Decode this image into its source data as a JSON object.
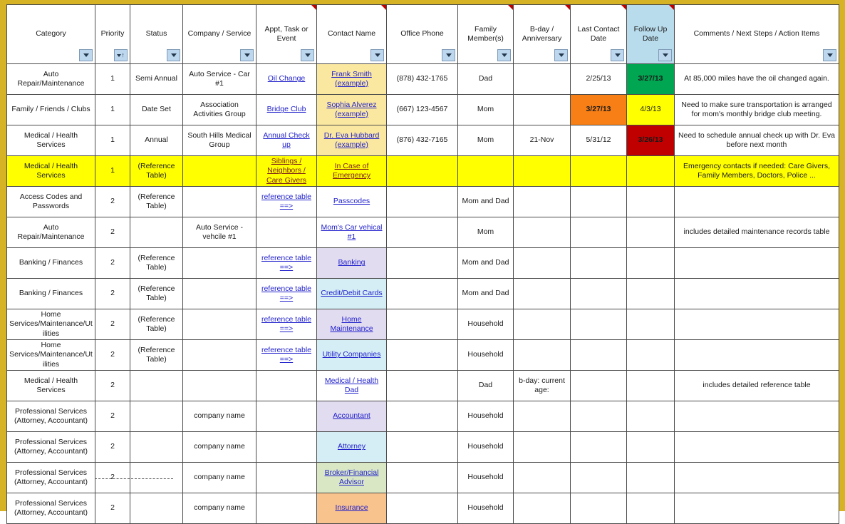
{
  "meta": {
    "doc_type": "spreadsheet",
    "accent_border": "#d6b325",
    "filter_button_color": "#bdd7ee",
    "comment_flag_color": "#c00000"
  },
  "columns": [
    {
      "label": "Category",
      "filter": true,
      "sorted": false,
      "comment_flag": false,
      "highlight": false
    },
    {
      "label": "Priority",
      "filter": true,
      "sorted": true,
      "comment_flag": false,
      "highlight": false
    },
    {
      "label": "Status",
      "filter": true,
      "sorted": false,
      "comment_flag": false,
      "highlight": false
    },
    {
      "label": "Company / Service",
      "filter": true,
      "sorted": false,
      "comment_flag": false,
      "highlight": false
    },
    {
      "label": "Appt, Task or Event",
      "filter": true,
      "sorted": false,
      "comment_flag": true,
      "highlight": false
    },
    {
      "label": "Contact Name",
      "filter": true,
      "sorted": false,
      "comment_flag": true,
      "highlight": false
    },
    {
      "label": "Office Phone",
      "filter": true,
      "sorted": false,
      "comment_flag": false,
      "highlight": false
    },
    {
      "label": "Family Member(s)",
      "filter": true,
      "sorted": false,
      "comment_flag": true,
      "highlight": false
    },
    {
      "label": "B-day / Anniversary",
      "filter": true,
      "sorted": false,
      "comment_flag": true,
      "highlight": false
    },
    {
      "label": "Last Contact Date",
      "filter": true,
      "sorted": false,
      "comment_flag": true,
      "highlight": false
    },
    {
      "label": "Follow Up Date",
      "filter": true,
      "sorted": false,
      "comment_flag": true,
      "highlight": true
    },
    {
      "label": "Comments / Next Steps / Action Items",
      "filter": true,
      "sorted": false,
      "comment_flag": false,
      "highlight": false
    }
  ],
  "rows": [
    {
      "row_style": "normal",
      "category": "Auto Repair/Maintenance",
      "priority": "1",
      "status": "Semi Annual",
      "company": "Auto Service - Car #1",
      "appt": "Oil Change",
      "appt_link": true,
      "contact": "Frank Smith (example)",
      "contact_link": true,
      "contact_bg": "cream",
      "phone": "(878) 432-1765",
      "family": "Dad",
      "bday": "",
      "last_contact": "2/25/13",
      "last_contact_bg": "",
      "follow_up": "3/27/13",
      "follow_up_bg": "green",
      "comments": "At 85,000 miles have the oil changed again."
    },
    {
      "row_style": "normal",
      "category": "Family / Friends / Clubs",
      "priority": "1",
      "status": "Date Set",
      "company": "Association Activities Group",
      "appt": "Bridge Club",
      "appt_link": true,
      "contact": "Sophia Alverez (example)",
      "contact_link": true,
      "contact_bg": "cream",
      "phone": "(667) 123-4567",
      "family": "Mom",
      "bday": "",
      "last_contact": "3/27/13",
      "last_contact_bg": "orange",
      "follow_up": "4/3/13",
      "follow_up_bg": "yellow-date",
      "comments": "Need to make sure transportation is arranged for mom's monthly bridge club meeting."
    },
    {
      "row_style": "normal",
      "category": "Medical / Health Services",
      "priority": "1",
      "status": "Annual",
      "company": "South Hills Medical Group",
      "appt": "Annual Check up",
      "appt_link": true,
      "contact": "Dr. Eva Hubbard (example)",
      "contact_link": true,
      "contact_bg": "cream",
      "phone": "(876) 432-7165",
      "family": "Mom",
      "bday": "21-Nov",
      "last_contact": "5/31/12",
      "last_contact_bg": "",
      "follow_up": "3/26/13",
      "follow_up_bg": "red",
      "comments": "Need to schedule annual check up with Dr. Eva before next month"
    },
    {
      "row_style": "yellow",
      "category": "Medical / Health Services",
      "priority": "1",
      "status": "(Reference Table)",
      "company": "",
      "appt": "Siblings / Neighbors / Care Givers",
      "appt_link": true,
      "contact": "In Case of Emergency",
      "contact_link": true,
      "contact_bg": "",
      "phone": "",
      "family": "",
      "bday": "",
      "last_contact": "",
      "last_contact_bg": "",
      "follow_up": "",
      "follow_up_bg": "",
      "comments": "Emergency contacts if needed: Care Givers, Family Members, Doctors, Police ..."
    },
    {
      "row_style": "normal",
      "category": "Access Codes and Passwords",
      "priority": "2",
      "status": "(Reference Table)",
      "company": "",
      "appt": "reference table ==>",
      "appt_link": true,
      "contact": "Passcodes",
      "contact_link": true,
      "contact_bg": "",
      "phone": "",
      "family": "Mom and Dad",
      "bday": "",
      "last_contact": "",
      "last_contact_bg": "",
      "follow_up": "",
      "follow_up_bg": "",
      "comments": ""
    },
    {
      "row_style": "normal",
      "category": "Auto Repair/Maintenance",
      "priority": "2",
      "status": "",
      "company": "Auto Service - vehcile #1",
      "appt": "",
      "appt_link": false,
      "contact": "Mom's Car vehical #1",
      "contact_link": true,
      "contact_bg": "",
      "phone": "",
      "family": "Mom",
      "bday": "",
      "last_contact": "",
      "last_contact_bg": "",
      "follow_up": "",
      "follow_up_bg": "",
      "comments": "includes detailed maintenance records table"
    },
    {
      "row_style": "normal",
      "category": "Banking / Finances",
      "priority": "2",
      "status": "(Reference Table)",
      "company": "",
      "appt": "reference table ==>",
      "appt_link": true,
      "contact": "Banking",
      "contact_link": true,
      "contact_bg": "lav",
      "phone": "",
      "family": "Mom and Dad",
      "bday": "",
      "last_contact": "",
      "last_contact_bg": "",
      "follow_up": "",
      "follow_up_bg": "",
      "comments": ""
    },
    {
      "row_style": "normal",
      "category": "Banking / Finances",
      "priority": "2",
      "status": "(Reference Table)",
      "company": "",
      "appt": "reference table ==>",
      "appt_link": true,
      "contact": "Credit/Debit Cards",
      "contact_link": true,
      "contact_bg": "lblue",
      "phone": "",
      "family": "Mom and Dad",
      "bday": "",
      "last_contact": "",
      "last_contact_bg": "",
      "follow_up": "",
      "follow_up_bg": "",
      "comments": ""
    },
    {
      "row_style": "normal",
      "category": "Home Services/Maintenance/Utilities",
      "priority": "2",
      "status": "(Reference Table)",
      "company": "",
      "appt": "reference table ==>",
      "appt_link": true,
      "contact": "Home Maintenance",
      "contact_link": true,
      "contact_bg": "lav",
      "phone": "",
      "family": "Household",
      "bday": "",
      "last_contact": "",
      "last_contact_bg": "",
      "follow_up": "",
      "follow_up_bg": "",
      "comments": ""
    },
    {
      "row_style": "normal",
      "category": "Home Services/Maintenance/Utilities",
      "priority": "2",
      "status": "(Reference Table)",
      "company": "",
      "appt": "reference table ==>",
      "appt_link": true,
      "contact": "Utility Companies",
      "contact_link": true,
      "contact_bg": "lblue",
      "phone": "",
      "family": "Household",
      "bday": "",
      "last_contact": "",
      "last_contact_bg": "",
      "follow_up": "",
      "follow_up_bg": "",
      "comments": ""
    },
    {
      "row_style": "normal",
      "category": "Medical / Health Services",
      "priority": "2",
      "status": "",
      "company": "",
      "appt": "",
      "appt_link": false,
      "contact": "Medical / Health Dad",
      "contact_link": true,
      "contact_bg": "",
      "phone": "",
      "family": "Dad",
      "bday": "b-day: current age:",
      "last_contact": "",
      "last_contact_bg": "",
      "follow_up": "",
      "follow_up_bg": "",
      "comments": "includes detailed reference table"
    },
    {
      "row_style": "normal",
      "category": "Professional Services (Attorney, Accountant)",
      "priority": "2",
      "status": "",
      "company": "company name",
      "appt": "",
      "appt_link": false,
      "contact": "Accountant",
      "contact_link": true,
      "contact_bg": "lav",
      "phone": "",
      "family": "Household",
      "bday": "",
      "last_contact": "",
      "last_contact_bg": "",
      "follow_up": "",
      "follow_up_bg": "",
      "comments": ""
    },
    {
      "row_style": "normal",
      "category": "Professional Services (Attorney, Accountant)",
      "priority": "2",
      "status": "",
      "company": "company name",
      "appt": "",
      "appt_link": false,
      "contact": "Attorney",
      "contact_link": true,
      "contact_bg": "lblue",
      "phone": "",
      "family": "Household",
      "bday": "",
      "last_contact": "",
      "last_contact_bg": "",
      "follow_up": "",
      "follow_up_bg": "",
      "comments": ""
    },
    {
      "row_style": "normal",
      "category": "Professional Services (Attorney, Accountant)",
      "priority": "2",
      "status": "",
      "company": "company name",
      "appt": "",
      "appt_link": false,
      "contact": "Broker/Financial Advisor",
      "contact_link": true,
      "contact_bg": "lgreen",
      "phone": "",
      "family": "Household",
      "bday": "",
      "last_contact": "",
      "last_contact_bg": "",
      "follow_up": "",
      "follow_up_bg": "",
      "comments": ""
    },
    {
      "row_style": "normal",
      "category": "Professional Services (Attorney, Accountant)",
      "priority": "2",
      "status": "",
      "company": "company name",
      "appt": "",
      "appt_link": false,
      "contact": "Insurance",
      "contact_link": true,
      "contact_bg": "peach",
      "phone": "",
      "family": "Household",
      "bday": "",
      "last_contact": "",
      "last_contact_bg": "",
      "follow_up": "",
      "follow_up_bg": "",
      "comments": ""
    }
  ]
}
